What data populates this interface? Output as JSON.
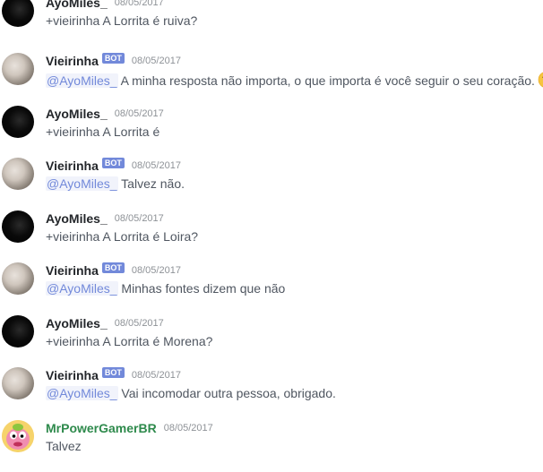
{
  "messages": [
    {
      "author": "AyoMiles_",
      "bot": false,
      "time": "08/05/2017",
      "mention": "",
      "text": "+vieirinha A Lorrita é ruiva?"
    },
    {
      "author": "Vieirinha",
      "bot": true,
      "bot_label": "BOT",
      "time": "08/05/2017",
      "mention": "@AyoMiles_",
      "text": " A minha resposta não importa, o que importa é você seguir o seu coração.",
      "emoji": "kissing-heart-emoji"
    },
    {
      "author": "AyoMiles_",
      "bot": false,
      "time": "08/05/2017",
      "mention": "",
      "text": "+vieirinha A Lorrita é"
    },
    {
      "author": "Vieirinha",
      "bot": true,
      "bot_label": "BOT",
      "time": "08/05/2017",
      "mention": "@AyoMiles_",
      "text": " Talvez não."
    },
    {
      "author": "AyoMiles_",
      "bot": false,
      "time": "08/05/2017",
      "mention": "",
      "text": "+vieirinha A Lorrita é Loira?"
    },
    {
      "author": "Vieirinha",
      "bot": true,
      "bot_label": "BOT",
      "time": "08/05/2017",
      "mention": "@AyoMiles_",
      "text": " Minhas fontes dizem que não"
    },
    {
      "author": "AyoMiles_",
      "bot": false,
      "time": "08/05/2017",
      "mention": "",
      "text": "+vieirinha A Lorrita é Morena?"
    },
    {
      "author": "Vieirinha",
      "bot": true,
      "bot_label": "BOT",
      "time": "08/05/2017",
      "mention": "@AyoMiles_",
      "text": " Vai incomodar outra pessoa, obrigado."
    },
    {
      "author": "MrPowerGamerBR",
      "bot": false,
      "time": "08/05/2017",
      "mention": "",
      "text": "Talvez"
    }
  ],
  "colors": {
    "bot_tag": "#7289da",
    "mention": "#7289da",
    "username": "#23262a",
    "mrpowergamer_name": "#2e8a4c",
    "timestamp": "#8e9297",
    "text": "#4f5660"
  }
}
